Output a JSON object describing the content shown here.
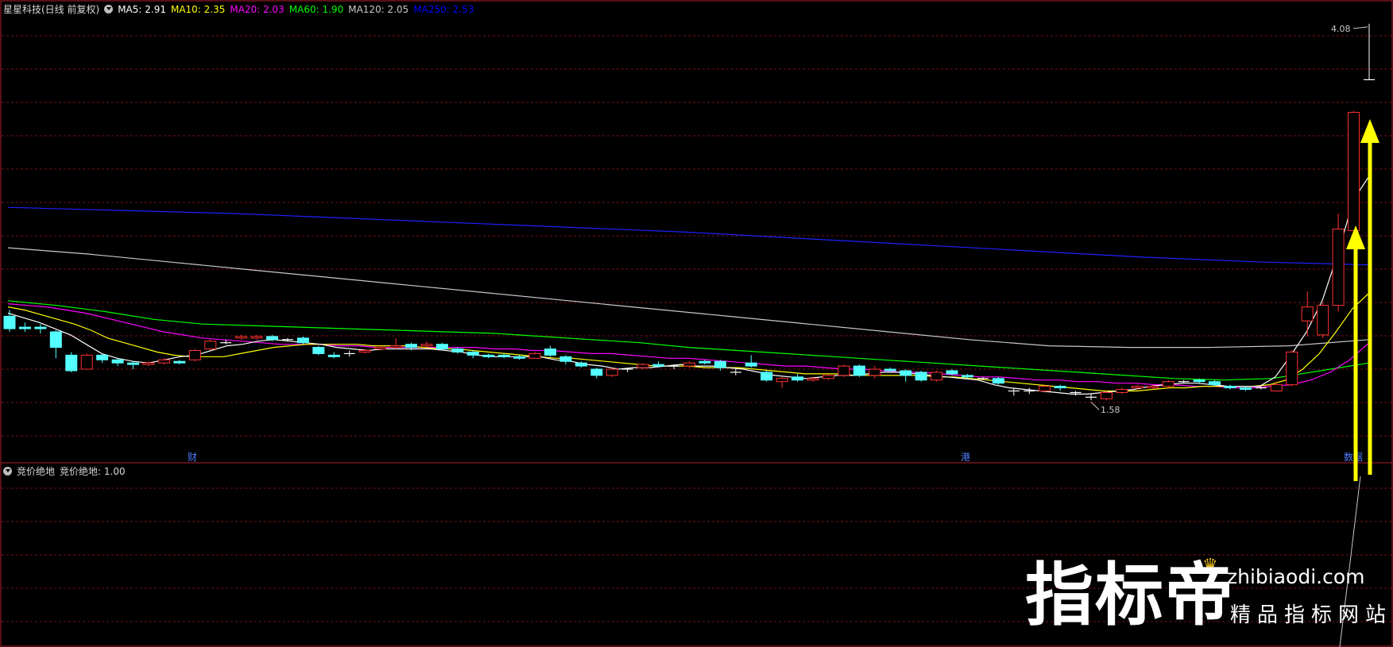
{
  "header": {
    "title": "星星科技(日线 前复权)",
    "ma": [
      {
        "label": "MA5: 2.91",
        "color": "#ffffff"
      },
      {
        "label": "MA10: 2.35",
        "color": "#ffff00"
      },
      {
        "label": "MA20: 2.03",
        "color": "#ff00ff"
      },
      {
        "label": "MA60: 1.90",
        "color": "#00ff00"
      },
      {
        "label": "MA120: 2.05",
        "color": "#c8c8c8"
      },
      {
        "label": "MA250: 2.53",
        "color": "#0000ff"
      }
    ]
  },
  "sub_header": {
    "title": "竞价绝地",
    "value": "竞价绝地: 1.00"
  },
  "watermark": {
    "main": "指标帝",
    "url": "zhibiaodi.com",
    "sub": "精品指标网站"
  },
  "chart_data": {
    "type": "candlestick",
    "ylim": [
      1.35,
      4.12
    ],
    "price_labels": {
      "high": "4.08",
      "low": "1.58"
    },
    "markers": [
      "财",
      "港",
      "数据"
    ],
    "ma_colors": {
      "ma5": "#ffffff",
      "ma10": "#ffff00",
      "ma20": "#ff00ff",
      "ma60": "#00ff00",
      "ma120": "#c8c8c8",
      "ma250": "#2020ff"
    },
    "candles": [
      [
        2.2,
        2.12,
        2.24,
        2.1
      ],
      [
        2.13,
        2.12,
        2.16,
        2.1
      ],
      [
        2.13,
        2.12,
        2.15,
        2.09
      ],
      [
        2.1,
        2.0,
        2.11,
        1.93
      ],
      [
        1.95,
        1.85,
        1.97,
        1.84
      ],
      [
        1.86,
        1.95,
        1.96,
        1.86
      ],
      [
        1.95,
        1.92,
        1.96,
        1.9
      ],
      [
        1.92,
        1.9,
        1.93,
        1.88
      ],
      [
        1.9,
        1.89,
        1.91,
        1.86
      ],
      [
        1.89,
        1.9,
        1.91,
        1.88
      ],
      [
        1.9,
        1.92,
        1.93,
        1.89
      ],
      [
        1.91,
        1.9,
        1.92,
        1.89
      ],
      [
        1.92,
        1.98,
        1.99,
        1.91
      ],
      [
        1.99,
        2.04,
        2.05,
        1.98
      ],
      [
        2.03,
        2.03,
        2.05,
        2.02
      ],
      [
        2.06,
        2.07,
        2.08,
        2.05
      ],
      [
        2.06,
        2.07,
        2.08,
        2.05
      ],
      [
        2.07,
        2.05,
        2.08,
        2.04
      ],
      [
        2.05,
        2.05,
        2.06,
        2.04
      ],
      [
        2.06,
        2.03,
        2.07,
        2.02
      ],
      [
        2.0,
        1.96,
        2.01,
        1.95
      ],
      [
        1.95,
        1.94,
        1.97,
        1.93
      ],
      [
        1.96,
        1.96,
        1.98,
        1.94
      ],
      [
        1.97,
        1.98,
        1.99,
        1.96
      ],
      [
        1.99,
        2.0,
        2.01,
        1.98
      ],
      [
        2.0,
        2.01,
        2.06,
        1.99
      ],
      [
        2.02,
        2.0,
        2.03,
        1.98
      ],
      [
        2.01,
        2.02,
        2.04,
        2.0
      ],
      [
        2.02,
        1.99,
        2.03,
        1.98
      ],
      [
        1.99,
        1.97,
        2.0,
        1.96
      ],
      [
        1.97,
        1.95,
        1.98,
        1.93
      ],
      [
        1.95,
        1.94,
        1.96,
        1.93
      ],
      [
        1.95,
        1.94,
        1.96,
        1.93
      ],
      [
        1.94,
        1.93,
        1.95,
        1.92
      ],
      [
        1.93,
        1.96,
        1.97,
        1.93
      ],
      [
        1.99,
        1.95,
        2.01,
        1.94
      ],
      [
        1.94,
        1.91,
        1.95,
        1.89
      ],
      [
        1.9,
        1.88,
        1.91,
        1.87
      ],
      [
        1.86,
        1.82,
        1.87,
        1.8
      ],
      [
        1.82,
        1.86,
        1.87,
        1.81
      ],
      [
        1.86,
        1.86,
        1.87,
        1.84
      ],
      [
        1.87,
        1.89,
        1.9,
        1.86
      ],
      [
        1.89,
        1.88,
        1.91,
        1.87
      ],
      [
        1.88,
        1.88,
        1.89,
        1.86
      ],
      [
        1.88,
        1.9,
        1.91,
        1.87
      ],
      [
        1.91,
        1.9,
        1.92,
        1.89
      ],
      [
        1.91,
        1.87,
        1.92,
        1.85
      ],
      [
        1.84,
        1.84,
        1.86,
        1.82
      ],
      [
        1.9,
        1.88,
        1.95,
        1.87
      ],
      [
        1.84,
        1.79,
        1.85,
        1.78
      ],
      [
        1.78,
        1.8,
        1.81,
        1.74
      ],
      [
        1.81,
        1.79,
        1.83,
        1.78
      ],
      [
        1.79,
        1.8,
        1.81,
        1.78
      ],
      [
        1.8,
        1.82,
        1.83,
        1.79
      ],
      [
        1.82,
        1.88,
        1.89,
        1.81
      ],
      [
        1.88,
        1.82,
        1.89,
        1.81
      ],
      [
        1.82,
        1.86,
        1.88,
        1.8
      ],
      [
        1.86,
        1.85,
        1.87,
        1.84
      ],
      [
        1.85,
        1.82,
        1.86,
        1.78
      ],
      [
        1.84,
        1.79,
        1.85,
        1.78
      ],
      [
        1.79,
        1.84,
        1.85,
        1.78
      ],
      [
        1.85,
        1.83,
        1.86,
        1.82
      ],
      [
        1.82,
        1.81,
        1.83,
        1.8
      ],
      [
        1.8,
        1.8,
        1.81,
        1.79
      ],
      [
        1.8,
        1.77,
        1.81,
        1.76
      ],
      [
        1.72,
        1.72,
        1.74,
        1.69
      ],
      [
        1.72,
        1.72,
        1.74,
        1.7
      ],
      [
        1.72,
        1.75,
        1.76,
        1.71
      ],
      [
        1.75,
        1.74,
        1.76,
        1.72
      ],
      [
        1.71,
        1.71,
        1.72,
        1.69
      ],
      [
        1.68,
        1.68,
        1.7,
        1.66
      ],
      [
        1.67,
        1.71,
        1.72,
        1.66
      ],
      [
        1.71,
        1.73,
        1.74,
        1.7
      ],
      [
        1.74,
        1.75,
        1.76,
        1.73
      ],
      [
        1.74,
        1.75,
        1.76,
        1.73
      ],
      [
        1.75,
        1.78,
        1.79,
        1.74
      ],
      [
        1.78,
        1.78,
        1.79,
        1.77
      ],
      [
        1.79,
        1.78,
        1.8,
        1.77
      ],
      [
        1.78,
        1.76,
        1.79,
        1.75
      ],
      [
        1.75,
        1.74,
        1.76,
        1.73
      ],
      [
        1.74,
        1.73,
        1.75,
        1.72
      ],
      [
        1.74,
        1.74,
        1.75,
        1.73
      ],
      [
        1.72,
        1.76,
        1.78,
        1.72
      ],
      [
        1.76,
        1.97,
        1.98,
        1.75
      ],
      [
        2.17,
        2.26,
        2.36,
        2.07
      ],
      [
        2.08,
        2.27,
        2.29,
        2.06
      ],
      [
        2.27,
        2.76,
        2.86,
        2.23
      ],
      [
        2.75,
        3.51,
        3.52,
        2.69
      ],
      [
        3.72,
        3.72,
        4.08,
        3.72
      ]
    ],
    "ma5": [
      2.22,
      2.19,
      2.16,
      2.12,
      2.08,
      2.02,
      1.96,
      1.93,
      1.91,
      1.9,
      1.92,
      1.94,
      1.95,
      1.98,
      2.01,
      2.02,
      2.04,
      2.05,
      2.04,
      2.03,
      2.02,
      2.0,
      1.99,
      1.98,
      1.99,
      1.99,
      1.99,
      1.99,
      1.98,
      1.97,
      1.95,
      1.94,
      1.94,
      1.94,
      1.94,
      1.92,
      1.91,
      1.89,
      1.88,
      1.86,
      1.87,
      1.87,
      1.88,
      1.89,
      1.88,
      1.88,
      1.87,
      1.86,
      1.84,
      1.82,
      1.81,
      1.8,
      1.81,
      1.82,
      1.82,
      1.83,
      1.84,
      1.84,
      1.83,
      1.82,
      1.81,
      1.8,
      1.79,
      1.76,
      1.74,
      1.73,
      1.72,
      1.71,
      1.7,
      1.7,
      1.71,
      1.72,
      1.73,
      1.75,
      1.76,
      1.77,
      1.77,
      1.76,
      1.75,
      1.75,
      1.75,
      1.81,
      1.95,
      2.1,
      2.3,
      2.6,
      2.95,
      3.1
    ],
    "ma10": [
      2.26,
      2.24,
      2.21,
      2.18,
      2.15,
      2.11,
      2.06,
      2.03,
      2.0,
      1.97,
      1.95,
      1.94,
      1.94,
      1.94,
      1.96,
      1.98,
      2.0,
      2.01,
      2.02,
      2.02,
      2.02,
      2.02,
      2.01,
      2.01,
      2.01,
      2.0,
      1.99,
      1.99,
      1.98,
      1.97,
      1.96,
      1.95,
      1.94,
      1.93,
      1.93,
      1.92,
      1.91,
      1.9,
      1.89,
      1.88,
      1.88,
      1.88,
      1.87,
      1.87,
      1.87,
      1.86,
      1.85,
      1.84,
      1.83,
      1.83,
      1.83,
      1.82,
      1.82,
      1.82,
      1.82,
      1.82,
      1.81,
      1.81,
      1.8,
      1.79,
      1.78,
      1.77,
      1.76,
      1.75,
      1.74,
      1.73,
      1.72,
      1.72,
      1.72,
      1.73,
      1.74,
      1.74,
      1.75,
      1.75,
      1.75,
      1.75,
      1.76,
      1.79,
      1.86,
      1.96,
      2.1,
      2.25,
      2.35
    ],
    "ma20": [
      2.28,
      2.27,
      2.26,
      2.24,
      2.22,
      2.19,
      2.16,
      2.13,
      2.1,
      2.08,
      2.06,
      2.05,
      2.04,
      2.03,
      2.02,
      2.02,
      2.02,
      2.01,
      2.01,
      2.0,
      2.0,
      2.0,
      2.0,
      2.0,
      2.0,
      1.99,
      1.99,
      1.98,
      1.98,
      1.97,
      1.96,
      1.96,
      1.95,
      1.94,
      1.93,
      1.93,
      1.92,
      1.91,
      1.9,
      1.89,
      1.88,
      1.88,
      1.87,
      1.86,
      1.86,
      1.85,
      1.84,
      1.84,
      1.83,
      1.82,
      1.81,
      1.81,
      1.8,
      1.79,
      1.79,
      1.78,
      1.78,
      1.77,
      1.77,
      1.76,
      1.76,
      1.75,
      1.75,
      1.74,
      1.74,
      1.75,
      1.76,
      1.79,
      1.84,
      1.92,
      2.03
    ],
    "ma60": [
      2.3,
      2.27,
      2.23,
      2.18,
      2.15,
      2.14,
      2.13,
      2.12,
      2.11,
      2.1,
      2.09,
      2.07,
      2.05,
      2.03,
      2.0,
      1.98,
      1.96,
      1.94,
      1.92,
      1.9,
      1.88,
      1.86,
      1.84,
      1.82,
      1.8,
      1.79,
      1.8,
      1.85,
      1.9
    ],
    "ma120": [
      2.64,
      2.6,
      2.55,
      2.5,
      2.45,
      2.4,
      2.35,
      2.3,
      2.25,
      2.2,
      2.15,
      2.1,
      2.05,
      2.01,
      2.0,
      2.0,
      2.01,
      2.05
    ],
    "ma250": [
      2.9,
      2.88,
      2.86,
      2.83,
      2.8,
      2.77,
      2.74,
      2.7,
      2.66,
      2.62,
      2.58,
      2.55,
      2.53
    ]
  }
}
